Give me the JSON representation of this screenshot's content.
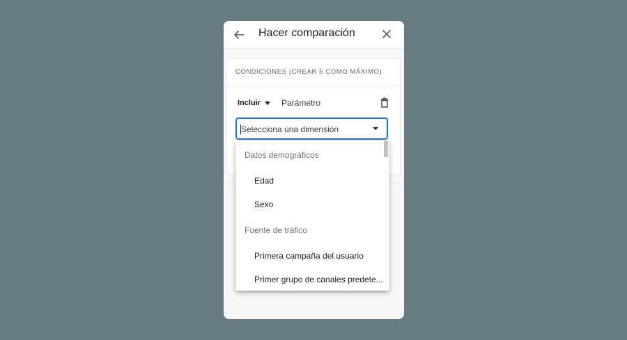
{
  "dialog": {
    "title": "Hacer comparación",
    "back_icon": "arrow-left-icon",
    "close_icon": "close-icon"
  },
  "conditions": {
    "header": "CONDICIONES (CREAR 5 COMO MÁXIMO)",
    "include_label": "Incluir",
    "parameter_label": "Parámetro",
    "delete_icon": "trash-icon",
    "dimension_select": {
      "placeholder": "Selecciona una dimensión"
    }
  },
  "dropdown": {
    "groups": [
      {
        "label": "Datos demográficos",
        "options": [
          "Edad",
          "Sexo"
        ]
      },
      {
        "label": "Fuente de tráfico",
        "options": [
          "Primera campaña del usuario",
          "Primer grupo de canales predete..."
        ]
      }
    ]
  },
  "colors": {
    "backdrop": "#687b83",
    "focus_border": "#1a73e8"
  }
}
